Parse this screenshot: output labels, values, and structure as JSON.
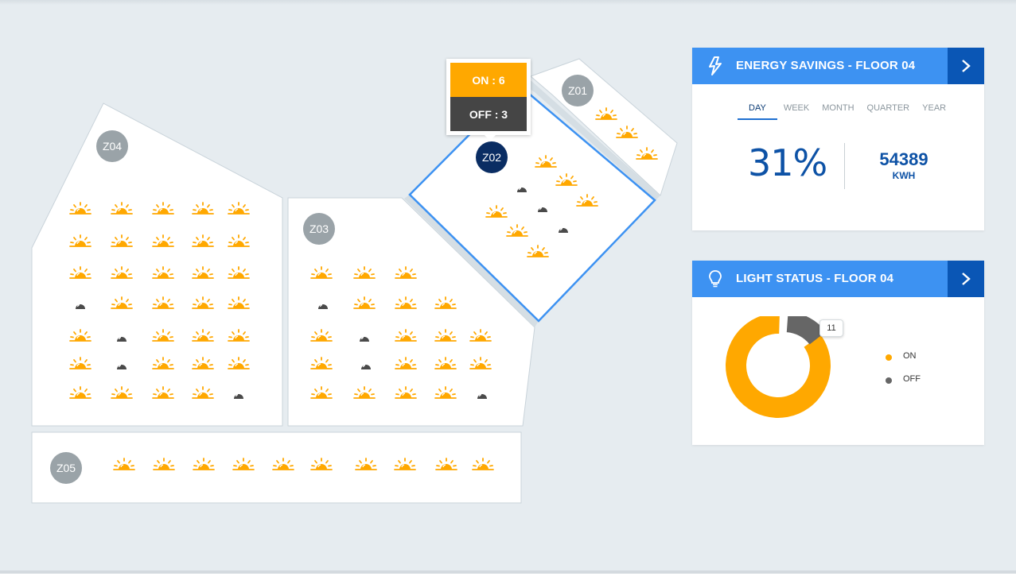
{
  "zones": {
    "z01": {
      "label": "Z01"
    },
    "z02": {
      "label": "Z02"
    },
    "z03": {
      "label": "Z03"
    },
    "z04": {
      "label": "Z04"
    },
    "z05": {
      "label": "Z05"
    }
  },
  "tooltip": {
    "on_text": "ON : 6",
    "off_text": "OFF : 3"
  },
  "energy": {
    "title": "ENERGY SAVINGS - FLOOR 04",
    "tabs": [
      "DAY",
      "WEEK",
      "MONTH",
      "QUARTER",
      "YEAR"
    ],
    "selected_tab": "DAY",
    "percent": "31%",
    "kwh_value": "54389",
    "kwh_unit": "KWH"
  },
  "light_status": {
    "title": "LIGHT STATUS - FLOOR 04",
    "badge": "11",
    "legend": [
      {
        "label": "ON",
        "color": "#ffa800"
      },
      {
        "label": "OFF",
        "color": "#666666"
      }
    ],
    "on_fraction": 0.86,
    "off_fraction": 0.14
  },
  "colors": {
    "accent": "#3d92f2",
    "accent_dark": "#0a56b5",
    "lamp_on": "#ffa800",
    "lamp_off": "#4a4a4a"
  }
}
